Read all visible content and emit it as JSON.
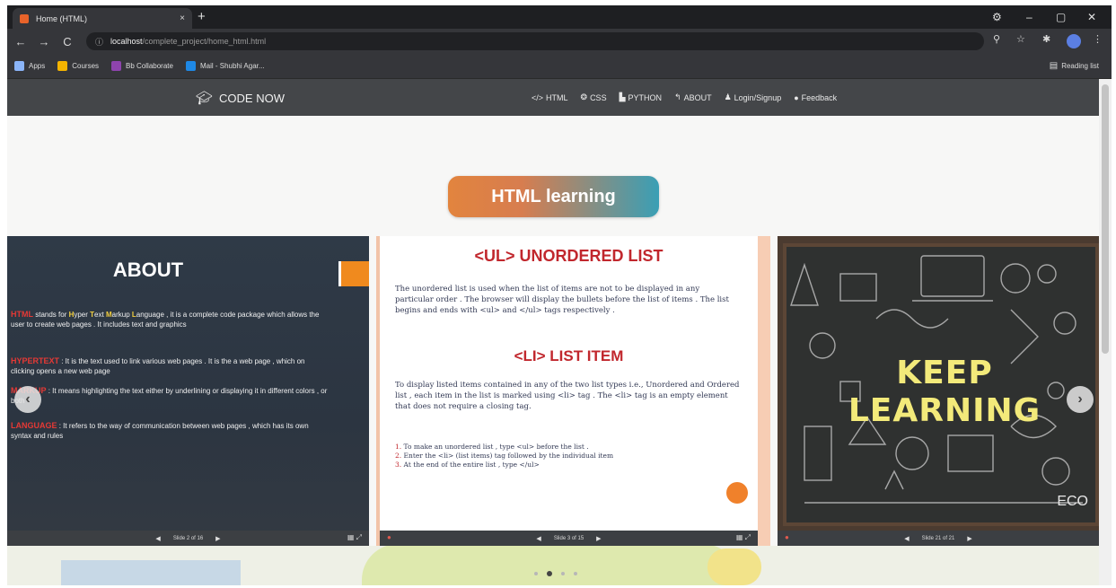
{
  "browser": {
    "tab_title": "Home (HTML)",
    "tab_close": "×",
    "new_tab": "+",
    "window_controls": [
      "⚙",
      "–",
      "▢",
      "✕"
    ],
    "nav_buttons": [
      "←",
      "→",
      "C"
    ],
    "url_host": "localhost",
    "url_path": "/complete_project/home_html.html",
    "toolbar_icons": [
      "search-icon",
      "star-icon",
      "extensions-icon",
      "menu-icon"
    ],
    "bookmarks": [
      {
        "label": "Apps",
        "color": "#8ab4f8"
      },
      {
        "label": "Courses",
        "color": "#f4b400"
      },
      {
        "label": "Bb Collaborate",
        "color": "#8e44ad"
      },
      {
        "label": "Mail - Shubhi Agar...",
        "color": "#1e88e5"
      }
    ],
    "reading_list": "Reading list"
  },
  "site_nav": {
    "brand": "CODE NOW",
    "brand_icon": "graduation-cap-icon",
    "links": [
      {
        "label": "HTML",
        "icon": "</>"
      },
      {
        "label": "CSS",
        "icon": "❂"
      },
      {
        "label": "PYTHON",
        "icon": "▙"
      },
      {
        "label": "ABOUT",
        "icon": "↰"
      },
      {
        "label": "Login/Signup",
        "icon": "♟"
      },
      {
        "label": "Feedback",
        "icon": "●"
      }
    ]
  },
  "hero": {
    "heading": "HTML learning"
  },
  "slides": {
    "about": {
      "title": "ABOUT",
      "paragraphs": [
        {
          "keyword": "HTML",
          "mid_pre": " stands for ",
          "hl": [
            "H",
            "yper ",
            "T",
            "ext ",
            "M",
            "arkup ",
            "L",
            "anguage"
          ],
          "rest": " , it is a complete code package which allows the user to create web pages . It includes text and graphics"
        },
        {
          "keyword": "HYPERTEXT",
          "text": " : It is the text used to link various web pages . It is the a web page , which on clicking opens a new web page"
        },
        {
          "keyword": "MARKUP",
          "text": " : It means highlighting the text either by underlining or displaying it in different colors , or both"
        },
        {
          "keyword": "LANGUAGE",
          "text": " : It refers to the way of communication between web pages , which has its own syntax and rules"
        }
      ],
      "footer_text": "Slide 2 of 16"
    },
    "lists": {
      "ul_title": "<UL> UNORDERED LIST",
      "ul_text": "The unordered list is used when the list of items are not to be displayed in any particular order . The browser will display the bullets before the list of items . The list begins and ends with <ul> and </ul> tags respectively .",
      "li_title": "<LI> LIST ITEM",
      "li_text": "To display listed items contained in any of the two list types i.e., Unordered and Ordered list , each item in the list is marked using <li> tag . The <li> tag is an empty element that does not require a closing tag.",
      "steps": [
        {
          "num": "1.",
          "text": " To make an unordered list , type <ul> before the list ."
        },
        {
          "num": "2.",
          "text": " Enter the <li> (list items) tag followed by the individual item"
        },
        {
          "num": "3.",
          "text": " At the end of the entire list , type </ul>"
        }
      ],
      "footer_text": "Slide 3 of 15"
    },
    "keep_learning": {
      "line1": "KEEP",
      "line2": "LEARNING",
      "corner_text": "ECO",
      "footer_text": "Slide 21 of 21"
    }
  },
  "carousel": {
    "prev": "‹",
    "next": "›",
    "dots": 4,
    "active_dot": 1
  }
}
